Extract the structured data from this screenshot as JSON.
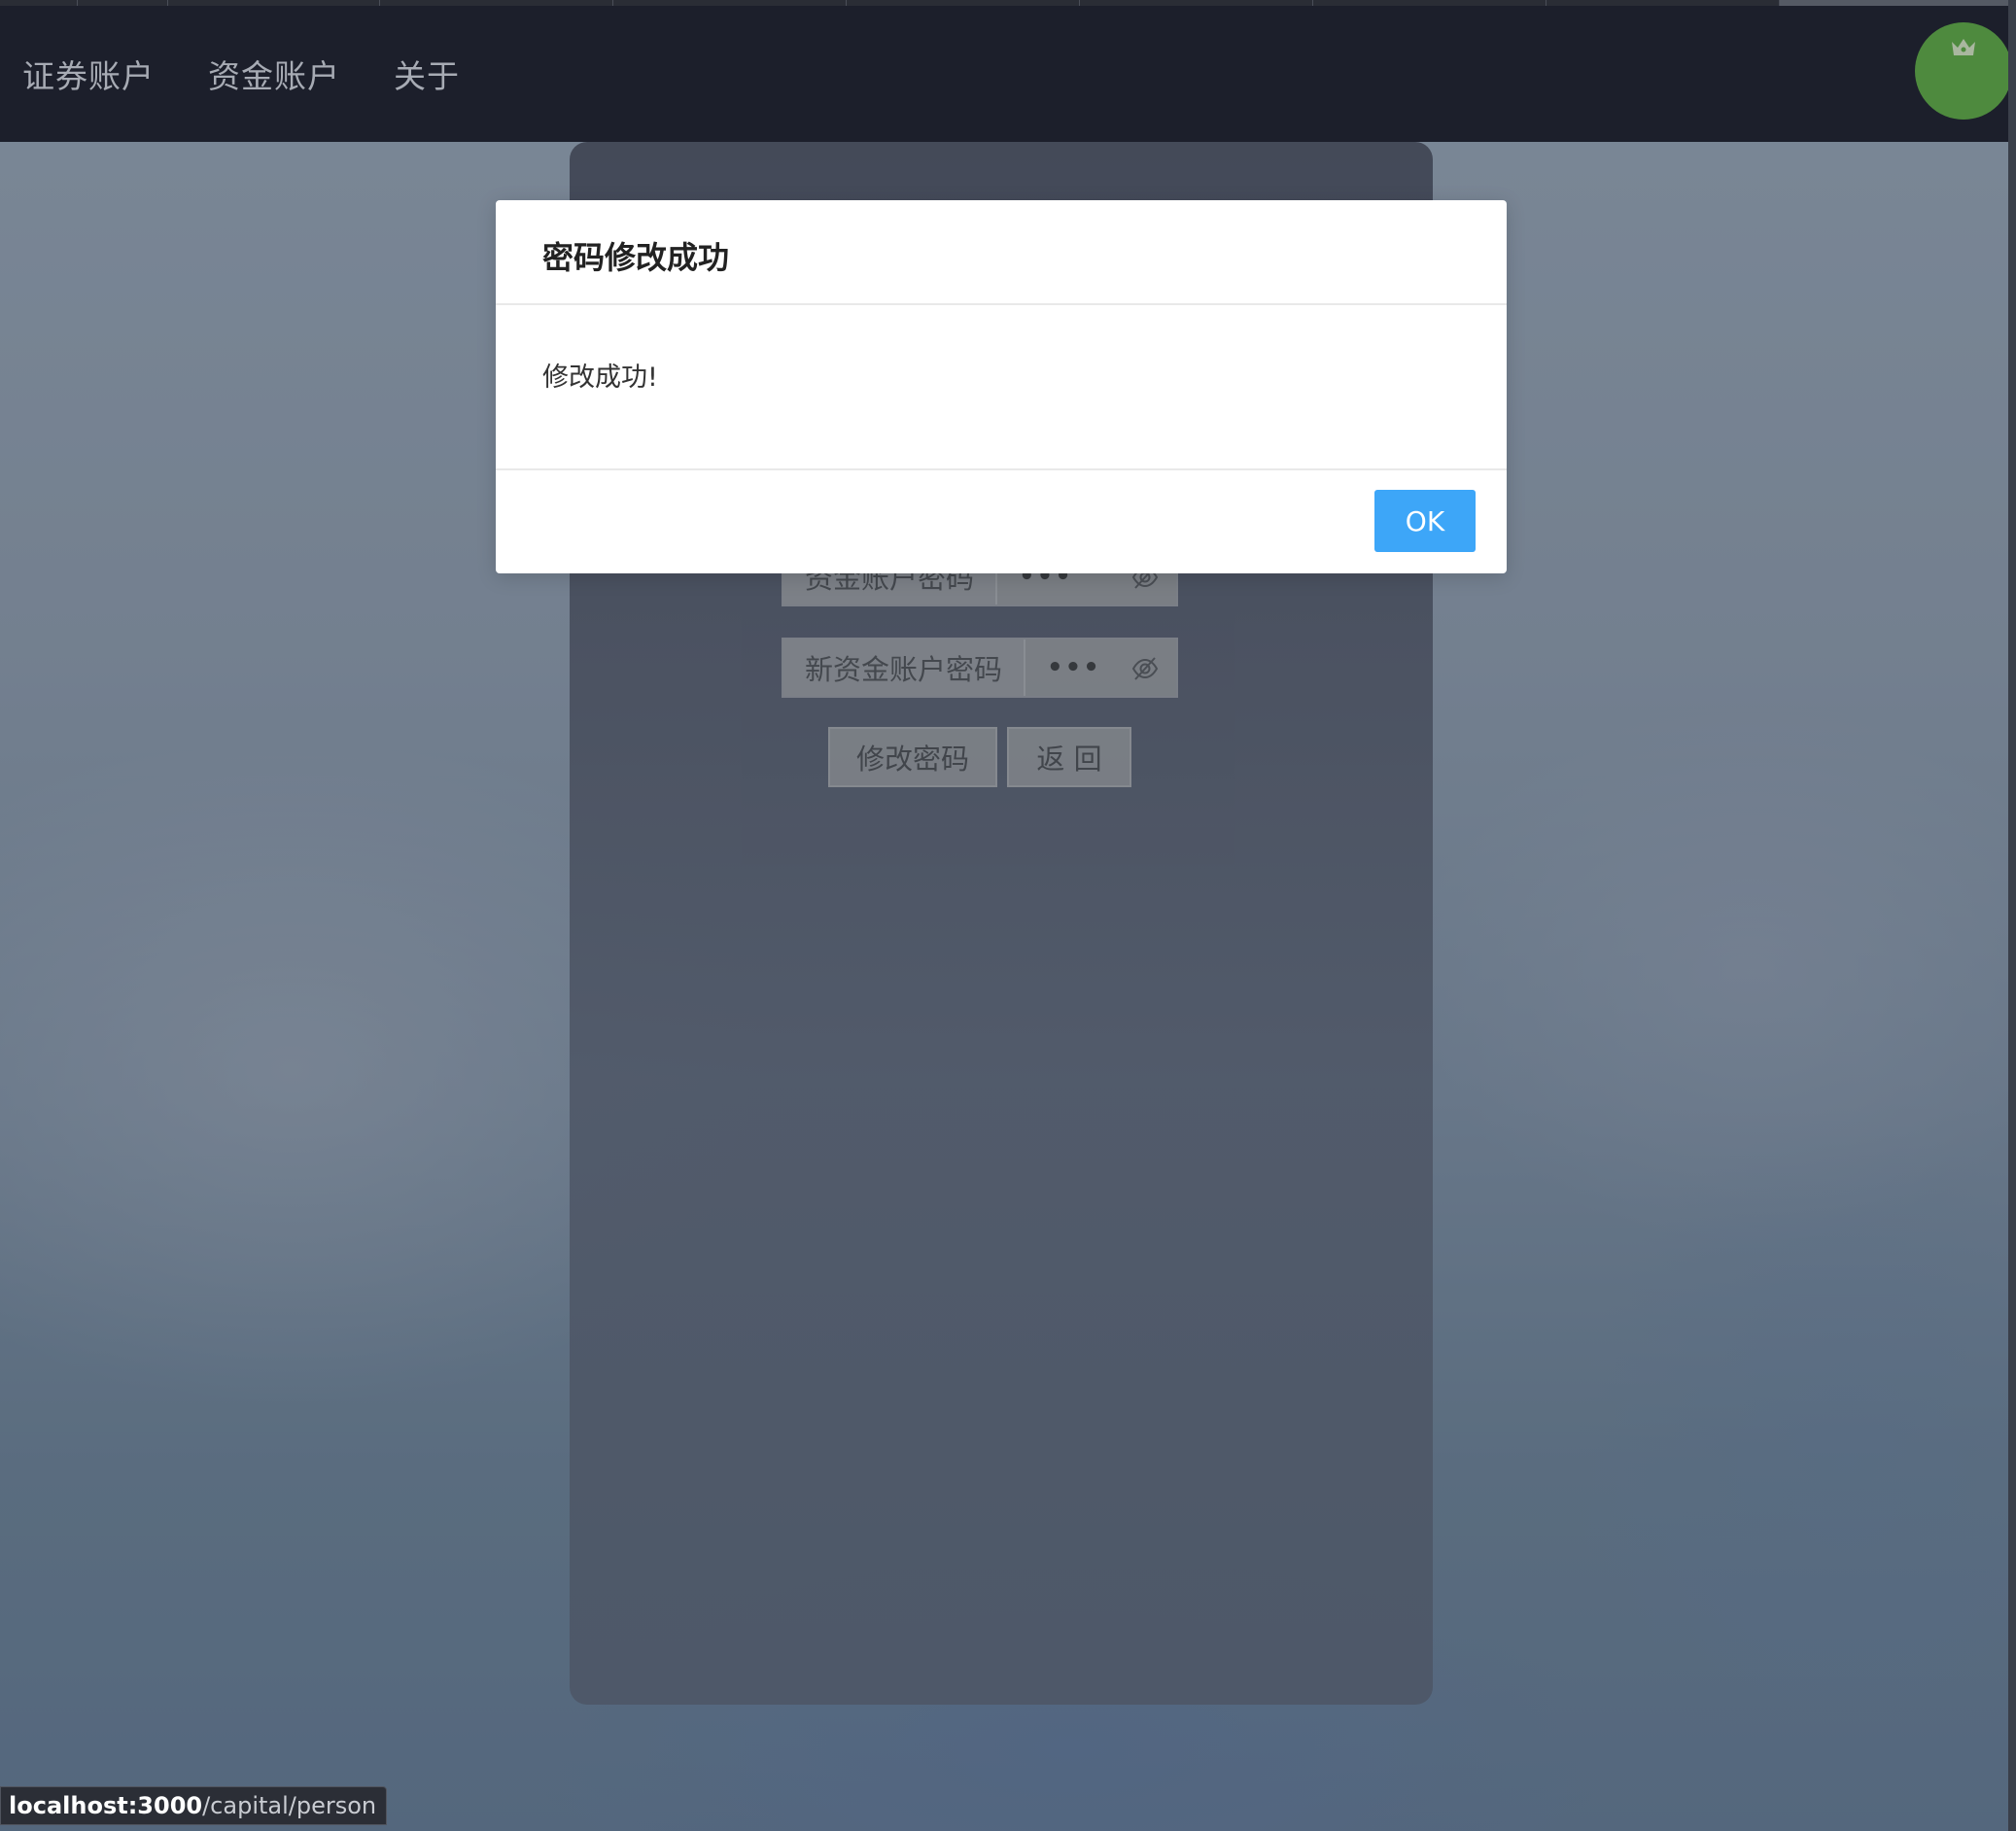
{
  "nav": {
    "items": [
      "证券账户",
      "资金账户",
      "关于"
    ]
  },
  "form": {
    "fields": [
      {
        "label": "资金账户密码",
        "value": "•••"
      },
      {
        "label": "新资金账户密码",
        "value": "•••"
      }
    ],
    "submit_label": "修改密码",
    "back_label": "返 回"
  },
  "modal": {
    "title": "密码修改成功",
    "message": "修改成功!",
    "ok_label": "OK"
  },
  "status_bar": {
    "host": "localhost:3000",
    "path": "/capital/person"
  },
  "colors": {
    "navbar_bg": "#1c1f2b",
    "ok_button": "#3da6f8",
    "avatar_bg": "#4e8a3e"
  },
  "icons": [
    "crown-icon",
    "eye-off-icon"
  ]
}
